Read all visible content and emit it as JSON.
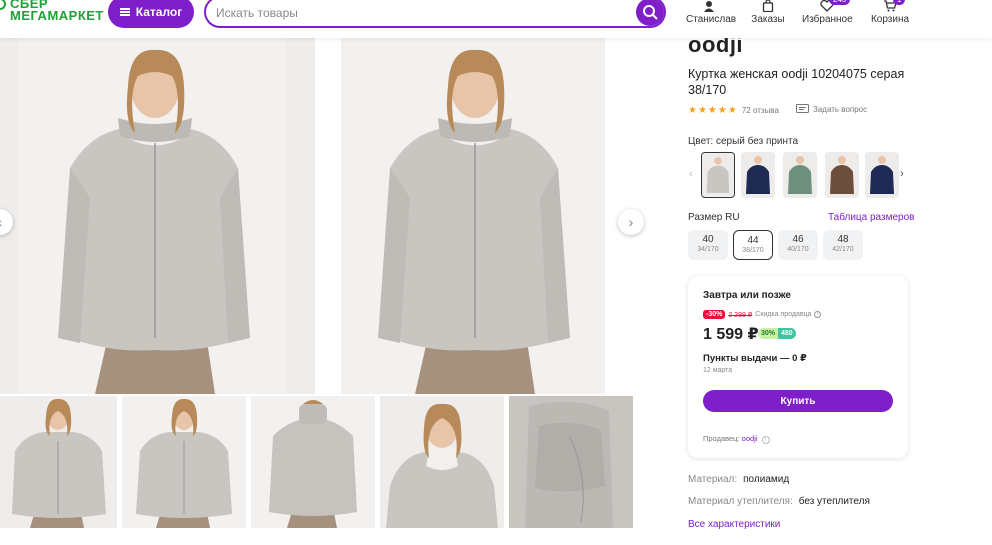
{
  "header": {
    "logo_top": "СБЕР",
    "logo_bottom": "МЕГАМАРКЕТ",
    "catalog_label": "Каталог",
    "search_placeholder": "Искать товары",
    "nav": [
      {
        "label": "Станислав",
        "icon": "profile-icon"
      },
      {
        "label": "Заказы",
        "icon": "bag-icon"
      },
      {
        "label": "Избранное",
        "icon": "heart-icon",
        "badge": "245"
      },
      {
        "label": "Корзина",
        "icon": "cart-icon",
        "badge": "1"
      }
    ]
  },
  "product": {
    "brand": "oodji",
    "title": "Куртка женская oodji 10204075 серая 38/170",
    "stars": "★★★★★",
    "reviews": "72 отзыва",
    "ask_question": "Задать вопрос",
    "color_label": "Цвет: серый без принта",
    "size_label": "Размер RU",
    "size_table_link": "Таблица размеров",
    "sizes": [
      {
        "ru": "40",
        "height": "34/170",
        "selected": false
      },
      {
        "ru": "44",
        "height": "38/170",
        "selected": true
      },
      {
        "ru": "46",
        "height": "40/170",
        "selected": false
      },
      {
        "ru": "48",
        "height": "42/170",
        "selected": false
      }
    ],
    "colors": [
      "#c9c5c1",
      "#1f2a52",
      "#6f8f7f",
      "#6b4e3c",
      "#1e2a55"
    ]
  },
  "offer": {
    "delivery": "Завтра или позже",
    "discount": "-30%",
    "old_price": "2 299 ₽",
    "discount_note": "Скидка продавца",
    "price": "1 599 ₽",
    "bonus_percent": "30%",
    "bonus_points": "480",
    "pickup": "Пункты выдачи — 0 ₽",
    "pickup_date": "12 марта",
    "buy_label": "Купить",
    "seller_label": "Продавец:",
    "seller_name": "oodji"
  },
  "specs": [
    {
      "name": "Материал:",
      "value": "полиамид"
    },
    {
      "name": "Материал утеплителя:",
      "value": "без утеплителя"
    }
  ],
  "all_specs_link": "Все характеристики",
  "colors": {
    "accent": "#7e1fc9",
    "brand_green": "#21a038",
    "sale_red": "#e8103b",
    "star": "#f8a21a"
  }
}
